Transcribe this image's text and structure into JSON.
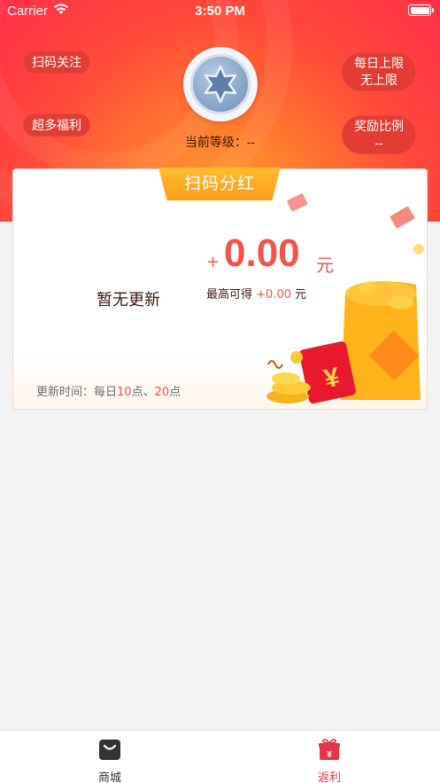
{
  "status_bar": {
    "carrier": "Carrier",
    "time": "3:50 PM"
  },
  "header": {
    "btn_scan_follow": "扫码关注",
    "btn_welfare": "超多福利",
    "daily_limit_line1": "每日上限",
    "daily_limit_line2": "无上限",
    "reward_ratio_line1": "奖励比例",
    "reward_ratio_line2": "--",
    "level_label": "当前等级：--"
  },
  "card": {
    "title": "扫码分红",
    "no_update": "暂无更新",
    "amount_prefix": "+",
    "amount": "0.00",
    "amount_unit": "元",
    "max_label": "最高可得",
    "max_value": "+0.00",
    "max_unit": "元",
    "update_prefix": "更新时间：每日",
    "update_hour1": "10",
    "update_sep": "点、",
    "update_hour2": "20",
    "update_suffix": "点",
    "illustration_text": "¥"
  },
  "tabbar": {
    "tabs": [
      {
        "label": "商城",
        "icon": "shopping-bag-icon",
        "color": "#333333"
      },
      {
        "label": "返利",
        "icon": "gift-icon",
        "color": "#e8344a"
      }
    ]
  },
  "colors": {
    "accent": "#f2544a",
    "tab_active": "#e8344a",
    "pill": "#e23c34"
  }
}
